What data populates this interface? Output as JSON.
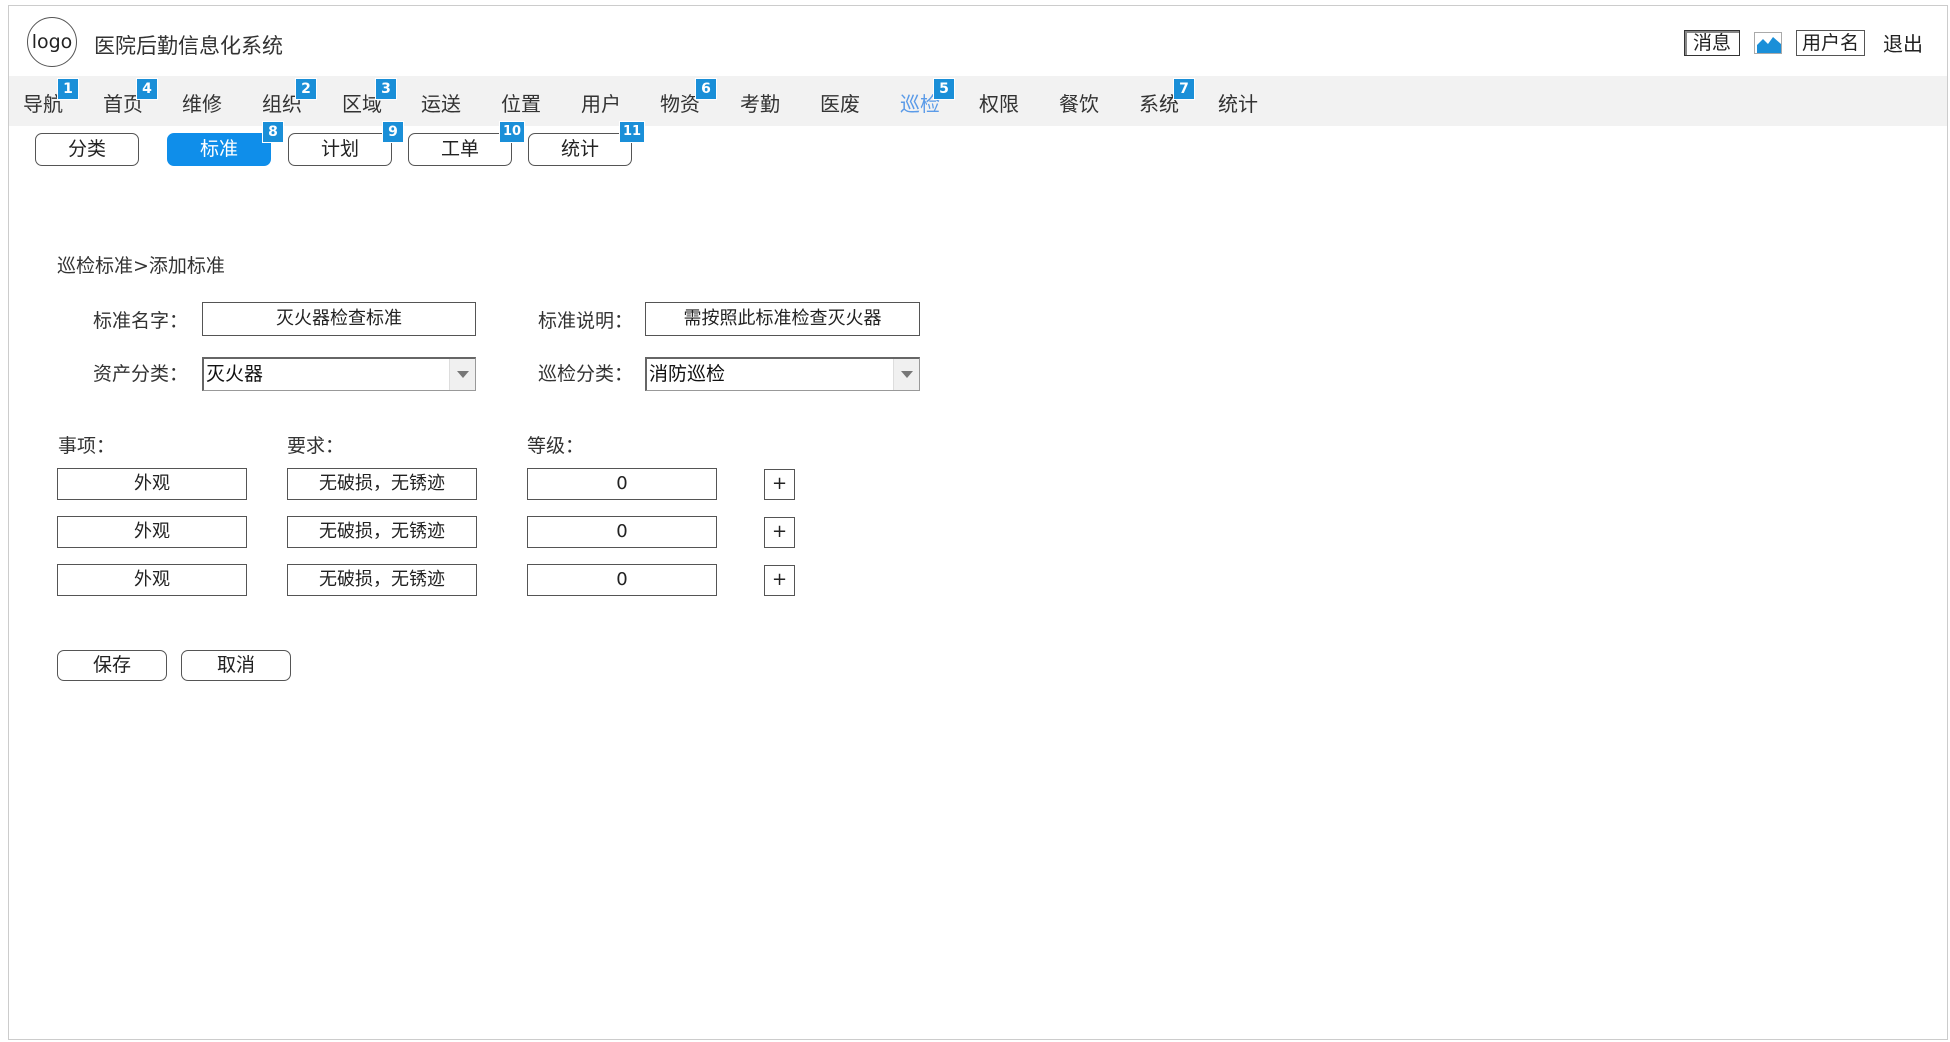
{
  "header": {
    "logo_text": "logo",
    "title": "医院后勤信息化系统",
    "message_label": "消息",
    "image_icon": "image-icon",
    "username": "用户名",
    "logout_label": "退出"
  },
  "nav": {
    "items": [
      {
        "label": "导航",
        "badge": "1"
      },
      {
        "label": "首页",
        "badge": "4"
      },
      {
        "label": "维修",
        "badge": ""
      },
      {
        "label": "组织",
        "badge": "2"
      },
      {
        "label": "区域",
        "badge": "3"
      },
      {
        "label": "运送",
        "badge": ""
      },
      {
        "label": "位置",
        "badge": ""
      },
      {
        "label": "用户",
        "badge": ""
      },
      {
        "label": "物资",
        "badge": "6"
      },
      {
        "label": "考勤",
        "badge": ""
      },
      {
        "label": "医废",
        "badge": ""
      },
      {
        "label": "巡检",
        "badge": "5",
        "active": true
      },
      {
        "label": "权限",
        "badge": ""
      },
      {
        "label": "餐饮",
        "badge": ""
      },
      {
        "label": "系统",
        "badge": "7"
      },
      {
        "label": "统计",
        "badge": ""
      }
    ]
  },
  "subtabs": {
    "items": [
      {
        "label": "分类",
        "badge": ""
      },
      {
        "label": "标准",
        "badge": "8",
        "active": true
      },
      {
        "label": "计划",
        "badge": "9"
      },
      {
        "label": "工单",
        "badge": "10"
      },
      {
        "label": "统计",
        "badge": "11"
      }
    ]
  },
  "breadcrumb": "巡检标准>添加标准",
  "form": {
    "standard_name_label": "标准名字：",
    "standard_name_value": "灭火器检查标准",
    "standard_desc_label": "标准说明：",
    "standard_desc_value": "需按照此标准检查灭火器",
    "asset_category_label": "资产分类：",
    "asset_category_value": "灭火器",
    "inspection_category_label": "巡检分类：",
    "inspection_category_value": "消防巡检"
  },
  "items_table": {
    "headers": {
      "item": "事项：",
      "requirement": "要求：",
      "level": "等级："
    },
    "rows": [
      {
        "item": "外观",
        "requirement": "无破损，无锈迹",
        "level": "0",
        "add": "+"
      },
      {
        "item": "外观",
        "requirement": "无破损，无锈迹",
        "level": "0",
        "add": "+"
      },
      {
        "item": "外观",
        "requirement": "无破损，无锈迹",
        "level": "0",
        "add": "+"
      }
    ]
  },
  "actions": {
    "save_label": "保存",
    "cancel_label": "取消"
  },
  "colors": {
    "accent": "#0f8eea",
    "badge": "#1a8fd8",
    "nav_active": "#5b9be8",
    "nav_bg": "#f2f2f2"
  }
}
